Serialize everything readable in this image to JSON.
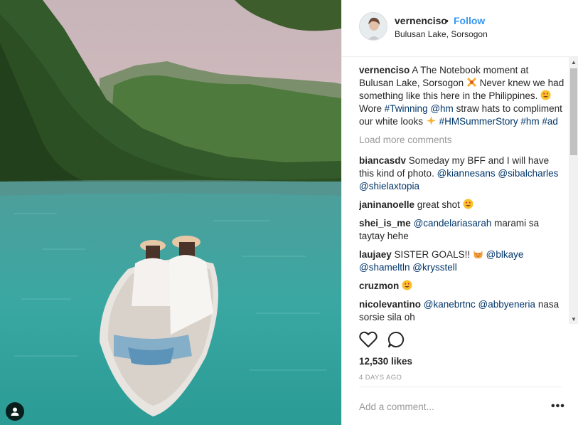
{
  "post": {
    "username": "vernenciso",
    "separator": "•",
    "follow_label": "Follow",
    "location": "Bulusan Lake, Sorsogon",
    "caption": {
      "user": "vernenciso",
      "t1": "A The Notebook moment at Bulusan Lake, Sorsogon",
      "t2": "Never knew we had something like this here in the Philippines.",
      "t3": "Wore",
      "h1": "#Twinning",
      "h2": "@hm",
      "t4": "straw hats to compliment our white looks",
      "h3": "#HMSummerStory",
      "h4": "#hm",
      "h5": "#ad"
    },
    "load_more": "Load more comments",
    "comments": [
      {
        "user": "biancasdv",
        "t1": "Someday my BFF and I will have this kind of photo.",
        "m1": "@kiannesans",
        "m2": "@sibalcharles",
        "m3": "@shielaxtopia"
      },
      {
        "user": "janinanoelle",
        "t1": "great shot"
      },
      {
        "user": "shei_is_me",
        "m1": "@candelariasarah",
        "t1": "marami sa taytay hehe"
      },
      {
        "user": "laujaey",
        "t1": "SISTER GOALS!!",
        "m1": "@blkaye",
        "m2": "@shameltln",
        "m3": "@krysstell"
      },
      {
        "user": "cruzmon"
      },
      {
        "user": "nicolevantino",
        "m1": "@kanebrtnc",
        "m2": "@abbyeneria",
        "t1": "nasa sorsie sila oh"
      }
    ],
    "likes": "12,530 likes",
    "time": "4 DAYS AGO",
    "add_comment_placeholder": "Add a comment...",
    "more_label": "•••"
  },
  "icons": {
    "like": "heart-icon",
    "comment": "comment-icon",
    "tagged": "user-tag-icon",
    "emoji_heart_eyes": "heart-eyes-emoji",
    "emoji_cat": "heart-eyes-cat-emoji",
    "emoji_ribbon": "ribbon-emoji",
    "emoji_sparkle": "sparkle-emoji"
  },
  "colors": {
    "link": "#003569",
    "follow": "#3897f0",
    "muted": "#999999",
    "text": "#262626",
    "lake": "#3aa7a2"
  }
}
